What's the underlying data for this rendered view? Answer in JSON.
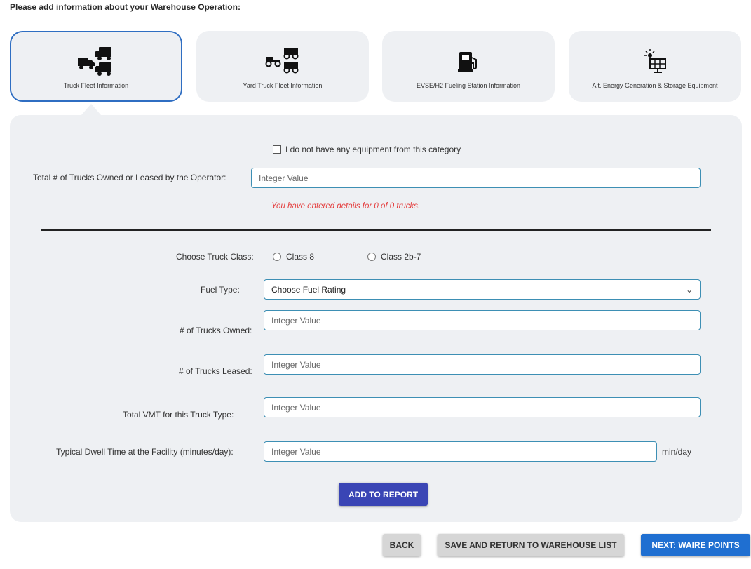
{
  "intro": "Please add information about your Warehouse Operation:",
  "tabs": [
    {
      "label": "Truck Fleet Information",
      "icon": "truck-fleet-icon",
      "active": true
    },
    {
      "label": "Yard Truck Fleet Information",
      "icon": "yard-truck-icon",
      "active": false
    },
    {
      "label": "EVSE/H2 Fueling Station Information",
      "icon": "fuel-pump-icon",
      "active": false
    },
    {
      "label": "Alt. Energy Generation & Storage Equipment",
      "icon": "solar-panel-icon",
      "active": false
    }
  ],
  "form": {
    "no_equipment_label": "I do not have any equipment from this category",
    "total_trucks_label": "Total # of Trucks Owned or Leased by the Operator:",
    "total_trucks_placeholder": "Integer Value",
    "warning": "You have entered details for 0 of 0 trucks.",
    "truck_class_label": "Choose Truck Class:",
    "truck_class_options": [
      "Class 8",
      "Class 2b-7"
    ],
    "fuel_type_label": "Fuel Type:",
    "fuel_type_value": "Choose Fuel Rating",
    "owned_label": "# of Trucks Owned:",
    "owned_placeholder": "Integer Value",
    "leased_label": "# of Trucks Leased:",
    "leased_placeholder": "Integer Value",
    "vmt_label": "Total VMT for this Truck Type:",
    "vmt_placeholder": "Integer Value",
    "dwell_label": "Typical Dwell Time at the Facility (minutes/day):",
    "dwell_placeholder": "Integer Value",
    "dwell_unit": "min/day",
    "add_button": "ADD TO REPORT"
  },
  "footer": {
    "back": "BACK",
    "save_return": "SAVE AND RETURN TO WAREHOUSE LIST",
    "next": "NEXT: WAIRE POINTS"
  },
  "colors": {
    "accent": "#2f6ec2",
    "warning": "#e43d3d",
    "primary_button": "#3a45b5",
    "next_button": "#1f6fd1",
    "panel": "#eef0f3"
  }
}
